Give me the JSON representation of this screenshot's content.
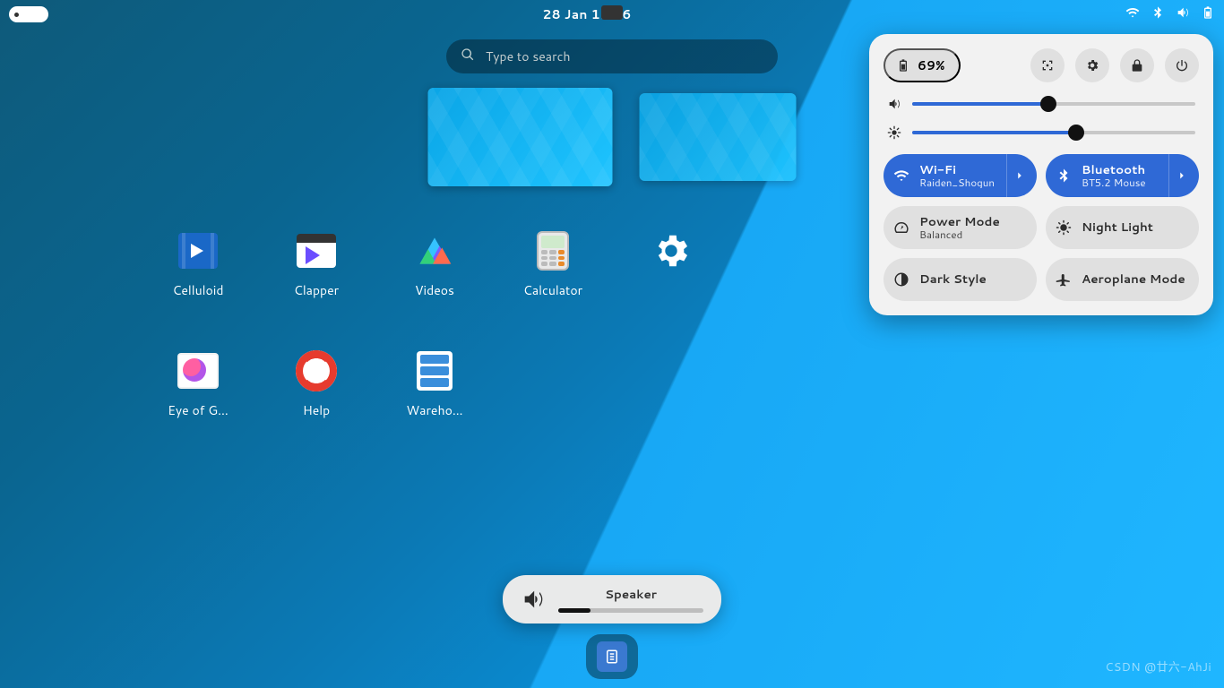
{
  "topbar": {
    "datetime": "28 Jan  12:36"
  },
  "search": {
    "placeholder": "Type to search"
  },
  "apps": [
    {
      "id": "celluloid",
      "label": "Celluloid"
    },
    {
      "id": "clapper",
      "label": "Clapper"
    },
    {
      "id": "videos",
      "label": "Videos"
    },
    {
      "id": "calculator",
      "label": "Calculator"
    },
    {
      "id": "settings",
      "label": ""
    },
    {
      "id": "eog",
      "label": "Eye of G…"
    },
    {
      "id": "help",
      "label": "Help"
    },
    {
      "id": "warehouse",
      "label": "Wareho…"
    }
  ],
  "qs": {
    "battery_pct": "69%",
    "volume": 48,
    "brightness": 58,
    "toggles": {
      "wifi": {
        "title": "Wi-Fi",
        "sub": "Raiden_Shogun",
        "active": true,
        "chevron": true
      },
      "bluetooth": {
        "title": "Bluetooth",
        "sub": "BT5.2 Mouse",
        "active": true,
        "chevron": true
      },
      "power": {
        "title": "Power Mode",
        "sub": "Balanced",
        "active": false,
        "chevron": false
      },
      "night": {
        "title": "Night Light",
        "sub": "",
        "active": false,
        "chevron": false
      },
      "dark": {
        "title": "Dark Style",
        "sub": "",
        "active": false,
        "chevron": false
      },
      "airplane": {
        "title": "Aeroplane Mode",
        "sub": "",
        "active": false,
        "chevron": false
      }
    }
  },
  "osd": {
    "title": "Speaker",
    "level": 22
  },
  "watermark": "CSDN @廿六-AhJi"
}
